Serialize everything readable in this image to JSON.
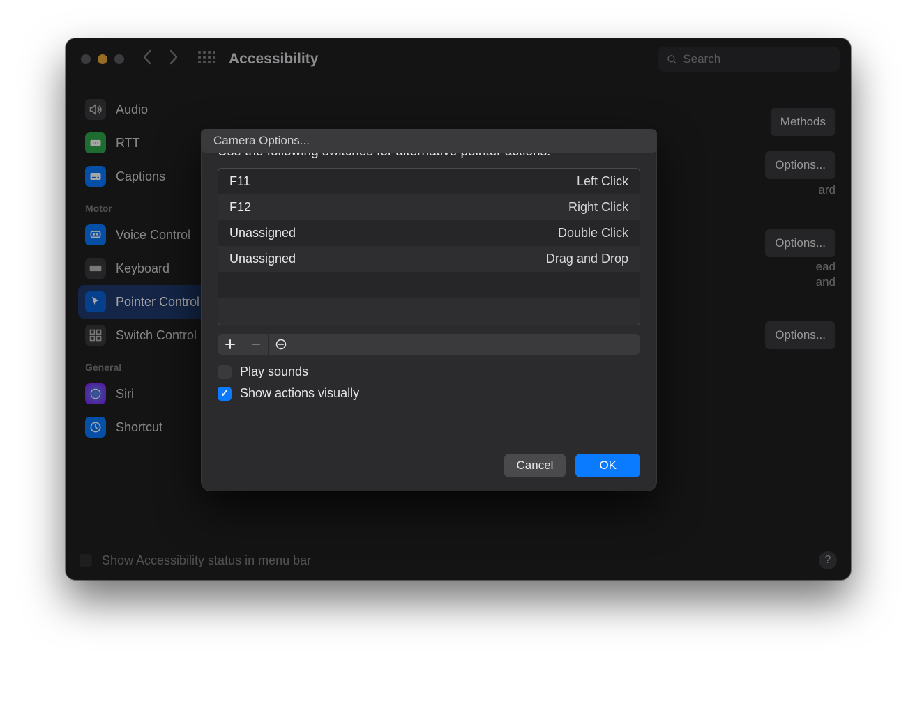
{
  "window": {
    "title": "Accessibility",
    "search_placeholder": "Search"
  },
  "sidebar": {
    "items": [
      {
        "label": "Audio"
      },
      {
        "label": "RTT"
      },
      {
        "label": "Captions"
      }
    ],
    "section_motor": "Motor",
    "motor_items": [
      {
        "label": "Voice Control"
      },
      {
        "label": "Keyboard"
      },
      {
        "label": "Pointer Control"
      },
      {
        "label": "Switch Control"
      }
    ],
    "section_general": "General",
    "general_items": [
      {
        "label": "Siri"
      },
      {
        "label": "Shortcut"
      }
    ]
  },
  "rightpane": {
    "btn_methods": "Methods",
    "btn_options1": "Options...",
    "text_ard": "ard",
    "btn_options2": "Options...",
    "text_ead": "ead",
    "text_and": "and",
    "btn_options3": "Options..."
  },
  "footer": {
    "label": "Show Accessibility status in menu bar",
    "help": "?"
  },
  "sheet": {
    "title": "Use the following switches for alternative pointer actions:",
    "rows": [
      {
        "key": "F11",
        "action": "Left Click"
      },
      {
        "key": "F12",
        "action": "Right Click"
      },
      {
        "key": "Unassigned",
        "action": "Double Click"
      },
      {
        "key": "Unassigned",
        "action": "Drag and Drop"
      }
    ],
    "play_sounds": "Play sounds",
    "show_actions": "Show actions visually",
    "camera_options": "Camera Options...",
    "cancel": "Cancel",
    "ok": "OK"
  }
}
